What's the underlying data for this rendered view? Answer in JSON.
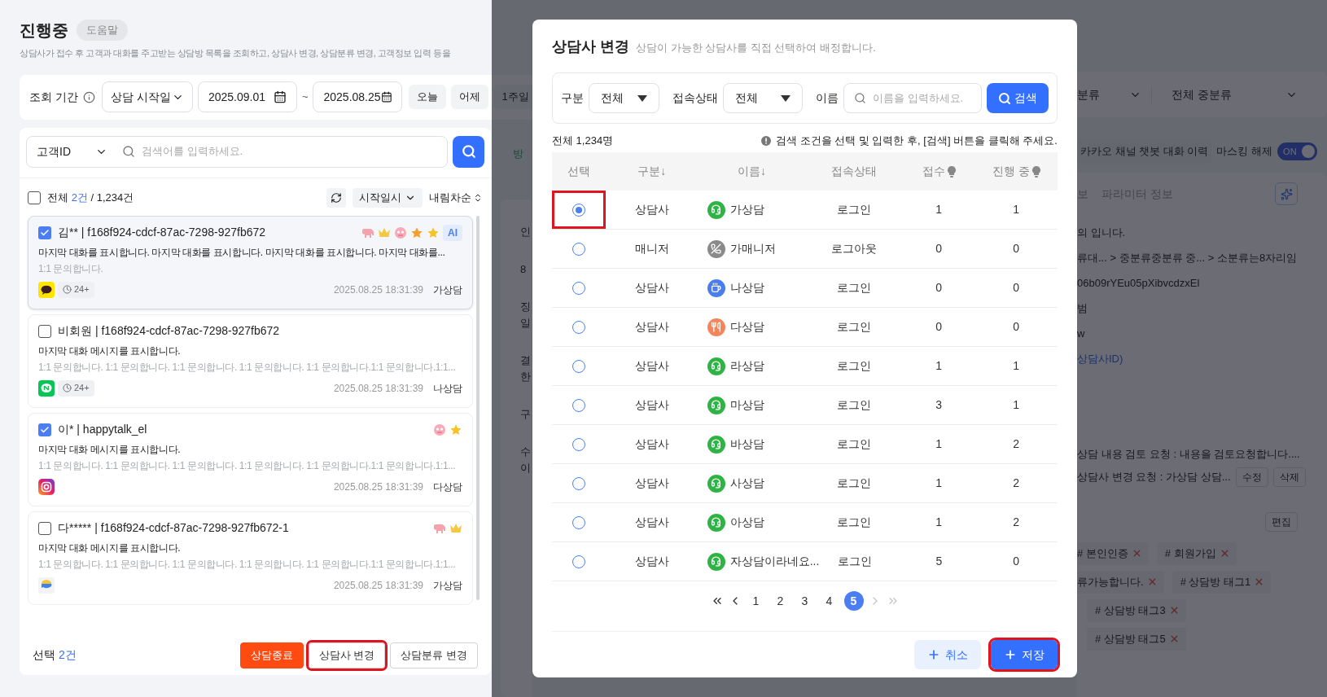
{
  "page": {
    "title": "진행중",
    "help_badge": "도움말",
    "description": "상담사가 접수 후 고객과 대화를 주고받는 상담방 목록을 조회하고, 상담사 변경, 상담분류 변경, 고객정보 입력 등을"
  },
  "period_filter": {
    "label": "조회 기간",
    "date_type": "상담 시작일",
    "start_date": "2025.09.01",
    "separator": "~",
    "end_date": "2025.08.25",
    "quick_buttons": [
      "오늘",
      "어제",
      "1주일"
    ]
  },
  "search": {
    "field": "고객ID",
    "placeholder": "검색어를 입력하세요."
  },
  "list_header": {
    "all_checked": false,
    "label": "전체",
    "selected_count": "2건",
    "total": "/ 1,234건",
    "sort_field": "시작일시",
    "sort_order": "내림차순"
  },
  "conversations": [
    {
      "checked": true,
      "selected": true,
      "title": "김** | f168f924-cdcf-87ac-7298-927fb672",
      "tags": [
        {
          "kind": "elephant"
        },
        {
          "kind": "crown"
        },
        {
          "kind": "face"
        },
        {
          "kind": "star",
          "color": "#f59e2b"
        },
        {
          "kind": "star",
          "color": "#f7c325"
        },
        {
          "kind": "text",
          "label": "AI"
        }
      ],
      "message": "마지막 대화를 표시합니다.  마지막 대화를 표시합니다. 마지막 대화를 표시합니다. 마지막 대화를...",
      "detail": "1:1 문의합니다.",
      "channel": {
        "kind": "kakao"
      },
      "wait": "24+",
      "time": "2025.08.25 18:31:39",
      "agent": "가상담"
    },
    {
      "checked": false,
      "selected": false,
      "title": "비회원 | f168f924-cdcf-87ac-7298-927fb672",
      "message": "마지막 대화 메시지를 표시합니다.",
      "detail": "1:1 문의합니다. 1:1 문의합니다. 1:1 문의합니다. 1:1 문의합니다. 1:1 문의합니다.1:1 문의합니다.1:1...",
      "channel": {
        "kind": "naver"
      },
      "wait": "24+",
      "time": "2025.08.25 18:31:39",
      "agent": "나상담"
    },
    {
      "checked": true,
      "selected": false,
      "title": "이* | happytalk_el",
      "tags": [
        {
          "kind": "face"
        },
        {
          "kind": "star",
          "color": "#f7c325"
        }
      ],
      "message": "마지막 대화 메시지를 표시합니다.",
      "detail": "1:1 문의합니다. 1:1 문의합니다. 1:1 문의합니다. 1:1 문의합니다. 1:1 문의합니다.1:1 문의합니다.1:1...",
      "channel": {
        "kind": "instagram"
      },
      "time": "2025.08.25 18:31:39",
      "agent": "다상담"
    },
    {
      "checked": false,
      "selected": false,
      "title": "다***** | f168f924-cdcf-87ac-7298-927fb672-1",
      "tags": [
        {
          "kind": "elephant"
        },
        {
          "kind": "crown"
        }
      ],
      "message": "마지막 대화 메시지를 표시합니다.",
      "detail": "1:1 문의합니다. 1:1 문의합니다. 1:1 문의합니다. 1:1 문의합니다. 1:1 문의합니다.1:1 문의합니다.1:1...",
      "channel": {
        "kind": "other"
      },
      "time": "2025.08.25 18:31:39",
      "agent": "가상담"
    }
  ],
  "bottom_bar": {
    "label": "선택",
    "count": "2건",
    "buttons": [
      {
        "label": "상담종료",
        "kind": "danger",
        "highlighted": false
      },
      {
        "label": "상담사 변경",
        "kind": "outline",
        "highlighted": true
      },
      {
        "label": "상담분류 변경",
        "kind": "outline",
        "highlighted": false
      }
    ]
  },
  "background": {
    "strip_tab": "방",
    "strip_rows": [
      "인",
      "8",
      "징",
      "일",
      "결",
      "한",
      "구",
      "수",
      "이"
    ],
    "category_filter": "분류",
    "subcategory_filter": "전체 중분류",
    "history_button": "카카오 채널 챗봇 대화 이력",
    "masking": {
      "label": "마스킹 해제",
      "on": true,
      "state_label": "ON"
    },
    "tabs": [
      "보",
      "파라미터 정보"
    ],
    "lines": [
      "의 입니다.",
      "류대... > 중분류중분류 중... > 소분류는8자리임",
      "06b09rYEu05pXibvcdzxEl",
      "범",
      "w"
    ],
    "link": "상담사ID)",
    "requests": [
      {
        "text": "상담 내용 검토 요청 : 내용을 검토요청합니다...."
      },
      {
        "text": "상담사 변경 요청 : 가상담 상담...",
        "actions": [
          "수정",
          "삭제"
        ]
      }
    ],
    "edit_button": "편집",
    "tag_rows": [
      {
        "leading_cut": true,
        "tags": [
          "# 본인인증",
          "# 회원가입"
        ]
      },
      {
        "leading_cut": true,
        "tags": [
          "류가능합니다.",
          "# 상담방 태그1"
        ]
      },
      {
        "leading_cut": false,
        "tags": [
          "# 상담방 태그3"
        ]
      },
      {
        "leading_cut": false,
        "tags": [
          "# 상담방 태그5"
        ]
      }
    ]
  },
  "modal": {
    "title": "상담사 변경",
    "subtitle": "상담이 가능한 상담사를 직접 선택하여 배정합니다.",
    "filters": {
      "type_label": "구분",
      "type_value": "전체",
      "status_label": "접속상태",
      "status_value": "전체",
      "name_label": "이름",
      "name_placeholder": "이름을 입력하세요.",
      "search_button": "검색"
    },
    "total": "전체 1,234명",
    "hint": "검색 조건을 선택 및 입력한 후, [검색] 버튼을 클릭해 주세요.",
    "columns": [
      {
        "label": "선택",
        "kind": "plain"
      },
      {
        "label": "구분↓",
        "kind": "plain"
      },
      {
        "label": "이름↓",
        "kind": "plain"
      },
      {
        "label": "접속상태",
        "kind": "plain"
      },
      {
        "label": "접수",
        "kind": "hint"
      },
      {
        "label": "진행 중",
        "kind": "hint"
      }
    ],
    "rows": [
      {
        "selected": true,
        "highlighted": true,
        "type": "상담사",
        "avatar": {
          "kind": "headset"
        },
        "name": "가상담",
        "status": "로그인",
        "received": "1",
        "in_progress": "1"
      },
      {
        "selected": false,
        "highlighted": false,
        "type": "매니저",
        "avatar": {
          "kind": "away"
        },
        "name": "가매니저",
        "status": "로그아웃",
        "received": "0",
        "in_progress": "0"
      },
      {
        "selected": false,
        "highlighted": false,
        "type": "상담사",
        "avatar": {
          "kind": "coffee"
        },
        "name": "나상담",
        "status": "로그인",
        "received": "0",
        "in_progress": "0"
      },
      {
        "selected": false,
        "highlighted": false,
        "type": "상담사",
        "avatar": {
          "kind": "meal"
        },
        "name": "다상담",
        "status": "로그인",
        "received": "0",
        "in_progress": "0"
      },
      {
        "selected": false,
        "highlighted": false,
        "type": "상담사",
        "avatar": {
          "kind": "headset"
        },
        "name": "라상담",
        "status": "로그인",
        "received": "1",
        "in_progress": "1"
      },
      {
        "selected": false,
        "highlighted": false,
        "type": "상담사",
        "avatar": {
          "kind": "headset"
        },
        "name": "마상담",
        "status": "로그인",
        "received": "3",
        "in_progress": "1"
      },
      {
        "selected": false,
        "highlighted": false,
        "type": "상담사",
        "avatar": {
          "kind": "headset"
        },
        "name": "바상담",
        "status": "로그인",
        "received": "1",
        "in_progress": "2"
      },
      {
        "selected": false,
        "highlighted": false,
        "type": "상담사",
        "avatar": {
          "kind": "headset"
        },
        "name": "사상담",
        "status": "로그인",
        "received": "1",
        "in_progress": "2"
      },
      {
        "selected": false,
        "highlighted": false,
        "type": "상담사",
        "avatar": {
          "kind": "headset"
        },
        "name": "아상담",
        "status": "로그인",
        "received": "1",
        "in_progress": "2"
      },
      {
        "selected": false,
        "highlighted": false,
        "type": "상담사",
        "avatar": {
          "kind": "headset"
        },
        "name": "자상담이라네요...",
        "status": "로그인",
        "received": "5",
        "in_progress": "0"
      }
    ],
    "pagination": {
      "first_disabled": false,
      "prev_disabled": false,
      "pages": [
        {
          "label": "1",
          "selected": false
        },
        {
          "label": "2",
          "selected": false
        },
        {
          "label": "3",
          "selected": false
        },
        {
          "label": "4",
          "selected": false
        },
        {
          "label": "5",
          "selected": true
        }
      ],
      "next_disabled": true,
      "last_disabled": true
    },
    "buttons": [
      {
        "label": "취소",
        "kind": "secondary",
        "highlighted": false
      },
      {
        "label": "저장",
        "kind": "primary",
        "highlighted": true
      }
    ]
  }
}
